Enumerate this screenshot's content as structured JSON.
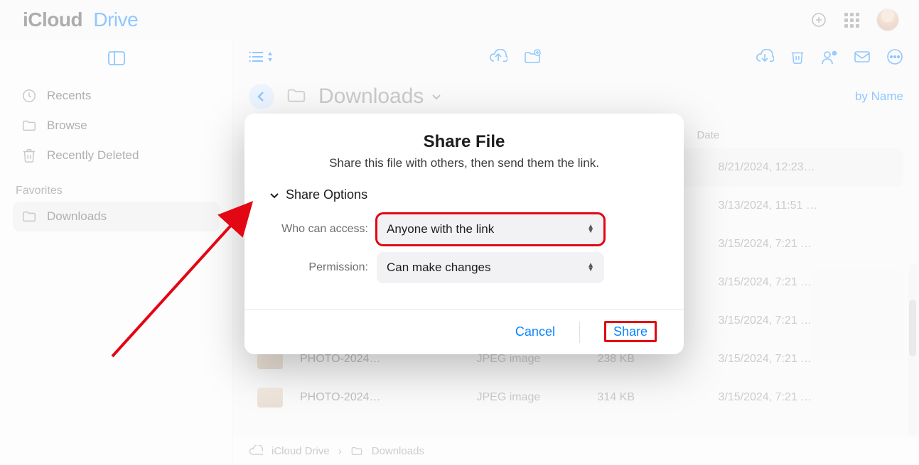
{
  "brand": {
    "prefix": "iCloud",
    "suffix": "Drive"
  },
  "sidebar": {
    "items": [
      {
        "label": "Recents",
        "icon": "clock-icon"
      },
      {
        "label": "Browse",
        "icon": "folder-icon"
      },
      {
        "label": "Recently Deleted",
        "icon": "trash-icon"
      }
    ],
    "favorites_heading": "Favorites",
    "favorites": [
      {
        "label": "Downloads",
        "icon": "folder-icon"
      }
    ]
  },
  "content": {
    "folder_title": "Downloads",
    "sort_label": "by Name",
    "columns": {
      "name": "",
      "kind": "",
      "size": "",
      "date": "Date"
    },
    "rows": [
      {
        "name": "",
        "kind": "",
        "size": "",
        "date": "8/21/2024, 12:23…",
        "selected": true
      },
      {
        "name": "",
        "kind": "",
        "size": "",
        "date": "3/13/2024, 11:51 …"
      },
      {
        "name": "",
        "kind": "",
        "size": "",
        "date": "3/15/2024, 7:21 …"
      },
      {
        "name": "",
        "kind": "",
        "size": "",
        "date": "3/15/2024, 7:21 …"
      },
      {
        "name": "",
        "kind": "",
        "size": "",
        "date": "3/15/2024, 7:21 …"
      },
      {
        "name": "PHOTO-2024…",
        "kind": "JPEG image",
        "size": "238 KB",
        "date": "3/15/2024, 7:21 …"
      },
      {
        "name": "PHOTO-2024…",
        "kind": "JPEG image",
        "size": "314 KB",
        "date": "3/15/2024, 7:21 …"
      }
    ],
    "breadcrumb": {
      "root": "iCloud Drive",
      "current": "Downloads"
    }
  },
  "modal": {
    "title": "Share File",
    "subtitle": "Share this file with others, then send them the link.",
    "options_label": "Share Options",
    "who_label": "Who can access:",
    "who_value": "Anyone with the link",
    "perm_label": "Permission:",
    "perm_value": "Can make changes",
    "cancel": "Cancel",
    "share": "Share"
  }
}
